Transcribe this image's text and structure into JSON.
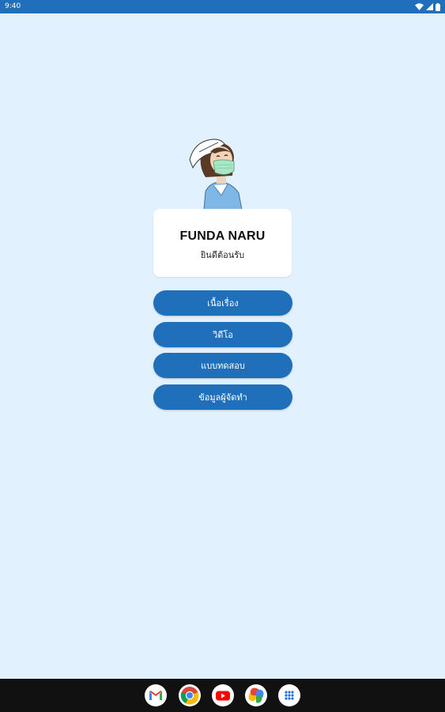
{
  "status_bar": {
    "time": "9:40",
    "icons": [
      "wifi-icon",
      "signal-icon",
      "battery-icon"
    ]
  },
  "welcome_card": {
    "title": "FUNDA NARU",
    "subtitle": "ยินดีต้อนรับ"
  },
  "menu": {
    "items": [
      {
        "label": "เนื้อเรื่อง"
      },
      {
        "label": "วิดีโอ"
      },
      {
        "label": "แบบทดสอบ"
      },
      {
        "label": "ข้อมูลผู้จัดทำ"
      }
    ]
  },
  "dock": {
    "apps": [
      "gmail-icon",
      "chrome-icon",
      "youtube-icon",
      "photos-icon",
      "app-drawer-icon"
    ]
  },
  "colors": {
    "background": "#e1f1fd",
    "accent": "#1f6fba",
    "card": "#ffffff",
    "nav_bar": "#111111"
  }
}
